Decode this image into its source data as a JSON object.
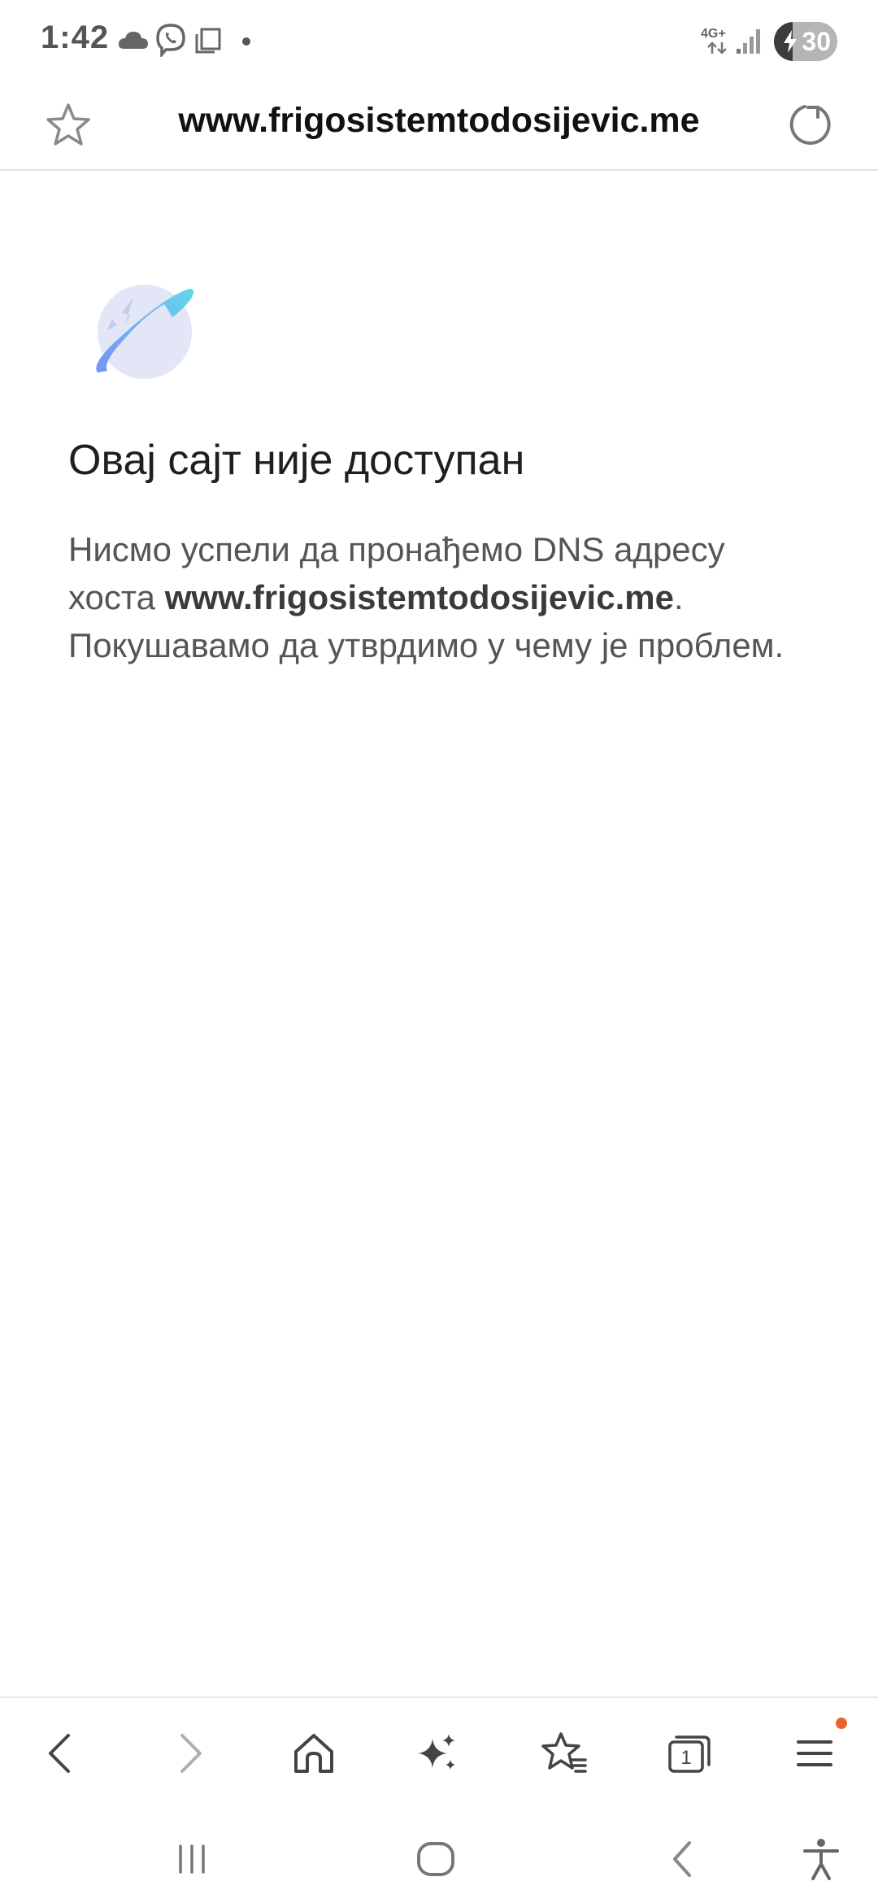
{
  "status_bar": {
    "time": "1:42",
    "network": "4G+",
    "battery_level": "30",
    "battery_fraction": 0.3,
    "icons": [
      "cloud-icon",
      "viber-icon",
      "screen-icon",
      "notification-dot",
      "signal-icon",
      "battery-charging-icon"
    ]
  },
  "address_bar": {
    "url": "www.frigosistemtodosijevic.me",
    "icons": [
      "bookmark-star-icon",
      "reload-icon"
    ]
  },
  "error_page": {
    "title": "Овај сајт није доступан",
    "message_before": "Нисмо успели да пронађемо DNS адресу хоста ",
    "host": "www.frigosistemtodosijevic.me",
    "message_after": ". Покушавамо да утврдимо у чему је проблем.",
    "icon": "globe-icon"
  },
  "toolbar": {
    "buttons": [
      "back-icon",
      "forward-icon",
      "home-icon",
      "ai-sparkle-icon",
      "bookmarks-icon",
      "tabs-icon",
      "menu-icon"
    ],
    "tab_count": "1",
    "accent_color": "#e8622c"
  },
  "navbar": {
    "buttons": [
      "recents-icon",
      "home-circle-icon",
      "back-chevron-icon",
      "accessibility-icon"
    ]
  }
}
